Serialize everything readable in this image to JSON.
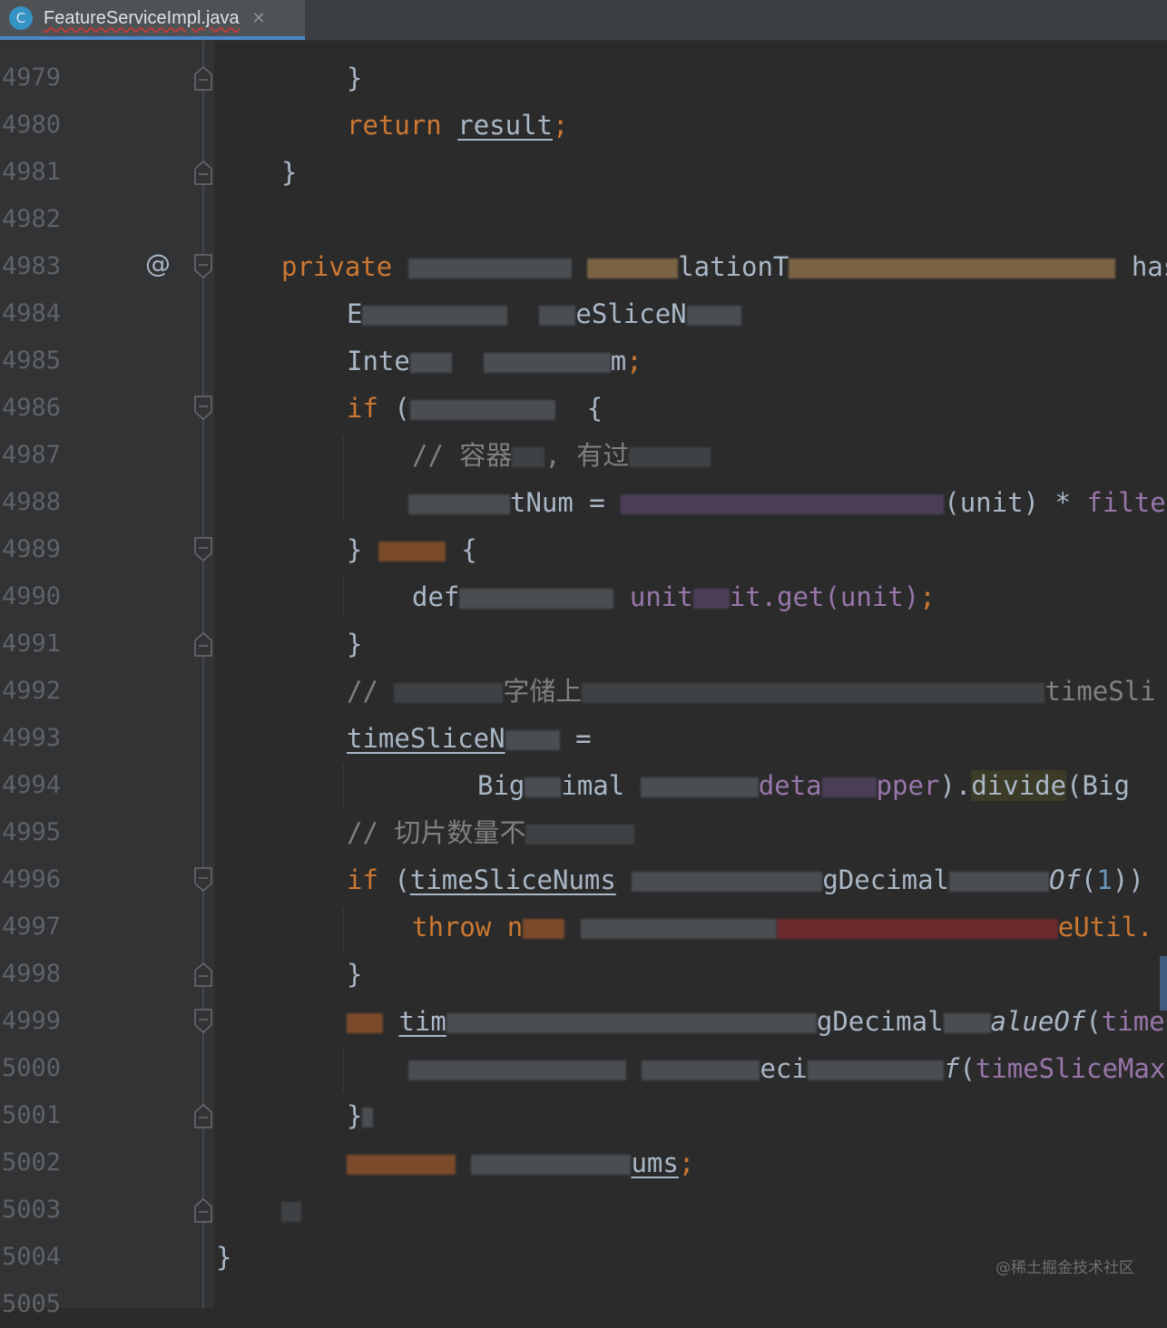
{
  "tab": {
    "icon_letter": "C",
    "filename": "FeatureServiceImpl.java",
    "close_glyph": "✕"
  },
  "gutter": {
    "line_numbers": [
      "4979",
      "4980",
      "4981",
      "4982",
      "4983",
      "4984",
      "4985",
      "4986",
      "4987",
      "4988",
      "4989",
      "4990",
      "4991",
      "4992",
      "4993",
      "4994",
      "4995",
      "4996",
      "4997",
      "4998",
      "4999",
      "5000",
      "5001",
      "5002",
      "5003",
      "5004",
      "5005"
    ],
    "annotation_glyph": "@"
  },
  "code": {
    "l4979": "}",
    "l4980_kw": "return",
    "l4980_var": "result",
    "l4980_end": ";",
    "l4981": "}",
    "l4983_kw": "private",
    "l4983_type": "lationT",
    "l4983_tail": "has",
    "l4984_a": "E",
    "l4984_b": "eSliceN",
    "l4985_a": "Inte",
    "l4985_b": "m",
    "l4985_end": ";",
    "l4986_kw": "if",
    "l4986_b": "(",
    "l4986_c": "{",
    "l4987_a": "// 容器",
    "l4987_b": ", 有过",
    "l4988_a": "tNum =",
    "l4988_b": "(unit) * ",
    "l4988_c": "filte",
    "l4989_a": "}",
    "l4989_b": "{",
    "l4990_a": "def",
    "l4990_b": "unit",
    "l4990_c": "it.get(unit)",
    "l4990_end": ";",
    "l4991": "}",
    "l4992_a": "//",
    "l4992_b": "字储上",
    "l4992_c": "timeSli",
    "l4993_a": "timeSliceN",
    "l4993_b": " =",
    "l4994_a": "Big",
    "l4994_b": "imal",
    "l4994_c": "deta",
    "l4994_d": "pper",
    "l4994_e": ").",
    "l4994_f": "divide",
    "l4994_g": "(Big",
    "l4995_a": "// 切片数量不",
    "l4996_kw": "if",
    "l4996_b": "(",
    "l4996_c": "timeSliceNums",
    "l4996_d": "gDecimal",
    "l4996_e": "Of",
    "l4996_f": "(",
    "l4996_g": "1",
    "l4996_h": "))",
    "l4997_kw": "throw",
    "l4997_b": "n",
    "l4997_c": "eUtil.",
    "l4998": "}",
    "l4999_a": "tim",
    "l4999_b": "gDecimal",
    "l4999_c": "alueOf",
    "l4999_d": "(",
    "l4999_e": "time",
    "l5000_a": "eci",
    "l5000_b": "f",
    "l5000_c": "(",
    "l5000_d": "timeSliceMax",
    "l5001": "}",
    "l5002_a": "ums",
    "l5002_end": ";",
    "l5004": "}"
  },
  "watermark": "@稀土掘金技术社区"
}
